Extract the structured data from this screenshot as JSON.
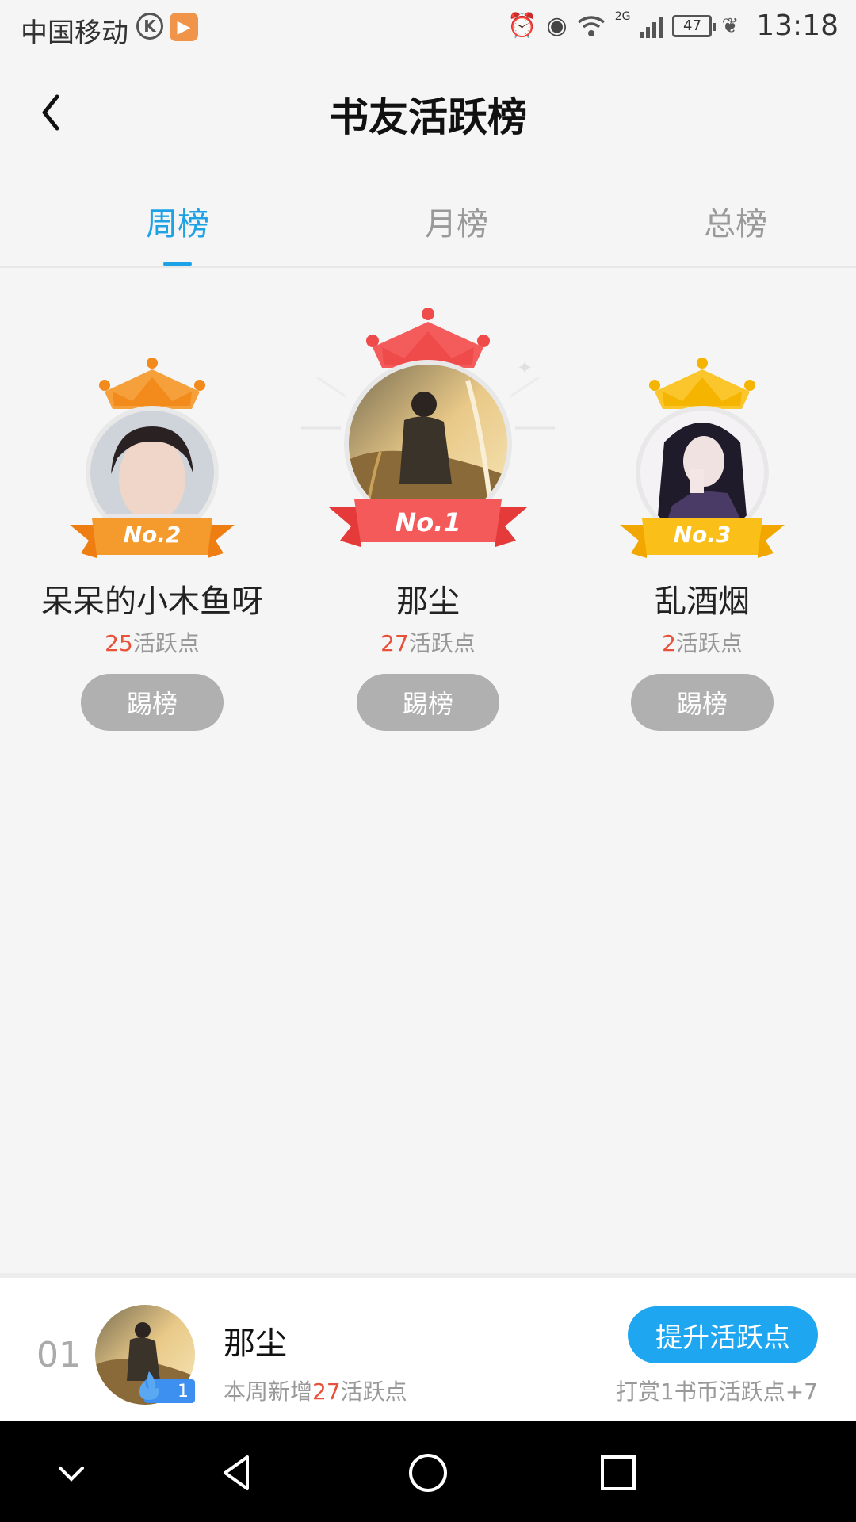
{
  "status_bar": {
    "carrier": "中国移动",
    "k_badge": "K",
    "network": "2G",
    "battery": "47",
    "time": "13:18"
  },
  "header": {
    "title": "书友活跃榜"
  },
  "tabs": [
    {
      "label": "周榜",
      "active": true
    },
    {
      "label": "月榜",
      "active": false
    },
    {
      "label": "总榜",
      "active": false
    }
  ],
  "podium": [
    {
      "rank_label": "No.2",
      "name": "呆呆的小木鱼呀",
      "points": "25",
      "points_suffix": "活跃点",
      "button": "踢榜"
    },
    {
      "rank_label": "No.1",
      "name": "那尘",
      "points": "27",
      "points_suffix": "活跃点",
      "button": "踢榜"
    },
    {
      "rank_label": "No.3",
      "name": "乱酒烟",
      "points": "2",
      "points_suffix": "活跃点",
      "button": "踢榜"
    }
  ],
  "my_rank": {
    "rank": "01",
    "level": "1",
    "name": "那尘",
    "desc_prefix": "本周新增",
    "desc_points": "27",
    "desc_suffix": "活跃点",
    "button": "提升活跃点",
    "tip": "打赏1书币活跃点+7"
  },
  "colors": {
    "accent": "#1ea2e6",
    "points": "#e8513a",
    "gold": "#f5a623",
    "red": "#ef4b4b",
    "orange": "#f28a1c"
  }
}
